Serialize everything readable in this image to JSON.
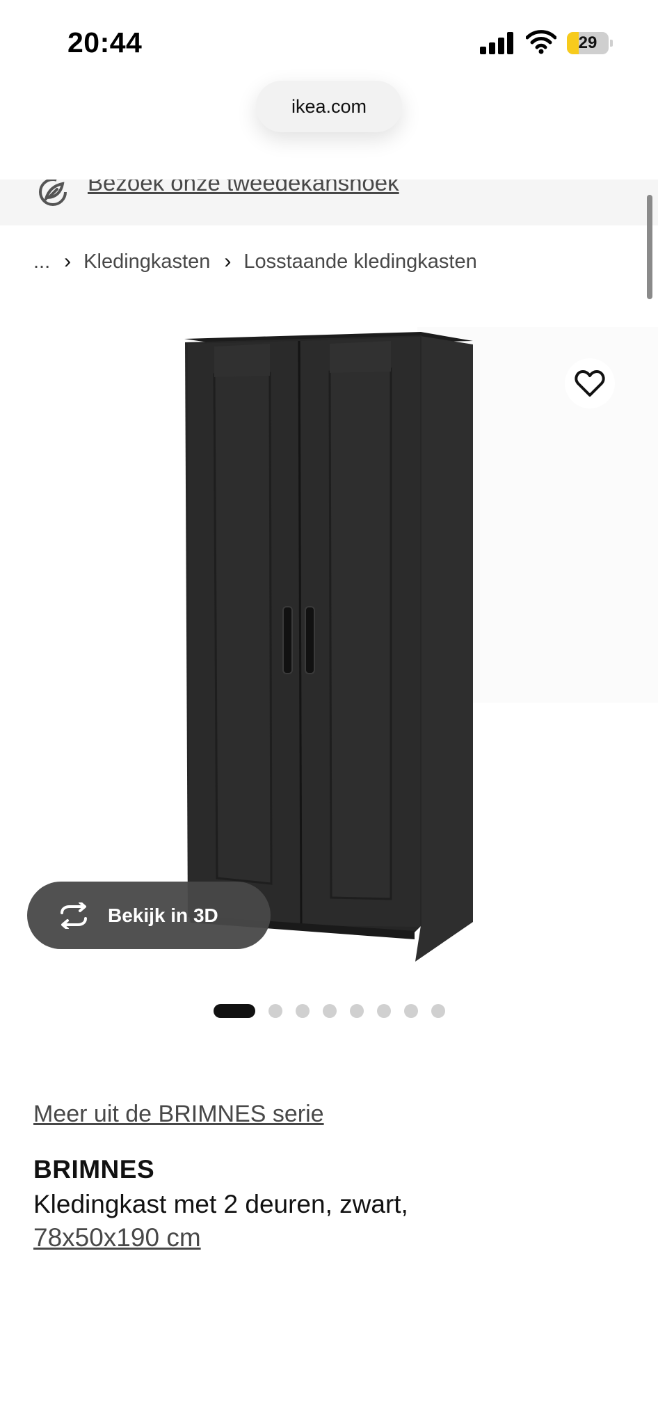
{
  "status_bar": {
    "time": "20:44",
    "battery_level": "29",
    "battery_fraction": 0.29,
    "icons": [
      "signal-icon",
      "wifi-icon",
      "battery-icon"
    ]
  },
  "browser": {
    "url": "ikea.com"
  },
  "banner": {
    "icon": "recycle-leaf-icon",
    "link_text": "Bezoek onze tweedekanshoek"
  },
  "breadcrumb": {
    "ellipsis": "...",
    "items": [
      "Kledingkasten",
      "Losstaande kledingkasten"
    ]
  },
  "gallery": {
    "favorite_icon": "heart-icon",
    "view_3d_label": "Bekijk in 3D",
    "view_3d_icon": "rotate-3d-icon",
    "image_count": 8,
    "active_index": 0
  },
  "product": {
    "series_link": "Meer uit de BRIMNES serie",
    "name": "BRIMNES",
    "description": "Kledingkast met 2 deuren, zwart,",
    "size": "78x50x190 cm"
  },
  "colors": {
    "accent_battery": "#f7cb1c",
    "wardrobe": "#2c2c2c",
    "button_3d_bg": "#484848"
  }
}
